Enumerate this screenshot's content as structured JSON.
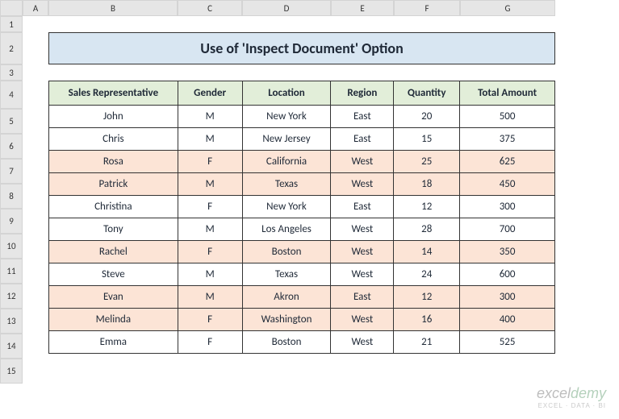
{
  "columns": [
    "A",
    "B",
    "C",
    "D",
    "E",
    "F",
    "G"
  ],
  "rowLabels": [
    "1",
    "2",
    "3",
    "4",
    "5",
    "6",
    "7",
    "8",
    "9",
    "10",
    "11",
    "12",
    "13",
    "14",
    "15"
  ],
  "title": "Use of 'Inspect Document' Option",
  "headers": {
    "rep": "Sales Representative",
    "gender": "Gender",
    "location": "Location",
    "region": "Region",
    "quantity": "Quantity",
    "total": "Total Amount"
  },
  "rows": [
    {
      "rep": "John",
      "gender": "M",
      "location": "New York",
      "region": "East",
      "quantity": "20",
      "total": "500",
      "hl": false
    },
    {
      "rep": "Chris",
      "gender": "M",
      "location": "New Jersey",
      "region": "East",
      "quantity": "15",
      "total": "375",
      "hl": false
    },
    {
      "rep": "Rosa",
      "gender": "F",
      "location": "California",
      "region": "West",
      "quantity": "25",
      "total": "625",
      "hl": true
    },
    {
      "rep": "Patrick",
      "gender": "M",
      "location": "Texas",
      "region": "West",
      "quantity": "18",
      "total": "450",
      "hl": true
    },
    {
      "rep": "Christina",
      "gender": "F",
      "location": "New York",
      "region": "East",
      "quantity": "12",
      "total": "300",
      "hl": false
    },
    {
      "rep": "Tony",
      "gender": "M",
      "location": "Los Angeles",
      "region": "West",
      "quantity": "28",
      "total": "700",
      "hl": false
    },
    {
      "rep": "Rachel",
      "gender": "F",
      "location": "Boston",
      "region": "West",
      "quantity": "14",
      "total": "350",
      "hl": true
    },
    {
      "rep": "Steve",
      "gender": "M",
      "location": "Texas",
      "region": "West",
      "quantity": "24",
      "total": "600",
      "hl": false
    },
    {
      "rep": "Evan",
      "gender": "M",
      "location": "Akron",
      "region": "East",
      "quantity": "12",
      "total": "300",
      "hl": true
    },
    {
      "rep": "Melinda",
      "gender": "F",
      "location": "Washington",
      "region": "West",
      "quantity": "16",
      "total": "400",
      "hl": true
    },
    {
      "rep": "Emma",
      "gender": "F",
      "location": "Boston",
      "region": "West",
      "quantity": "21",
      "total": "525",
      "hl": false
    }
  ],
  "watermark": {
    "brand1": "excel",
    "brand2": "demy",
    "tagline": "EXCEL · DATA · BI"
  }
}
